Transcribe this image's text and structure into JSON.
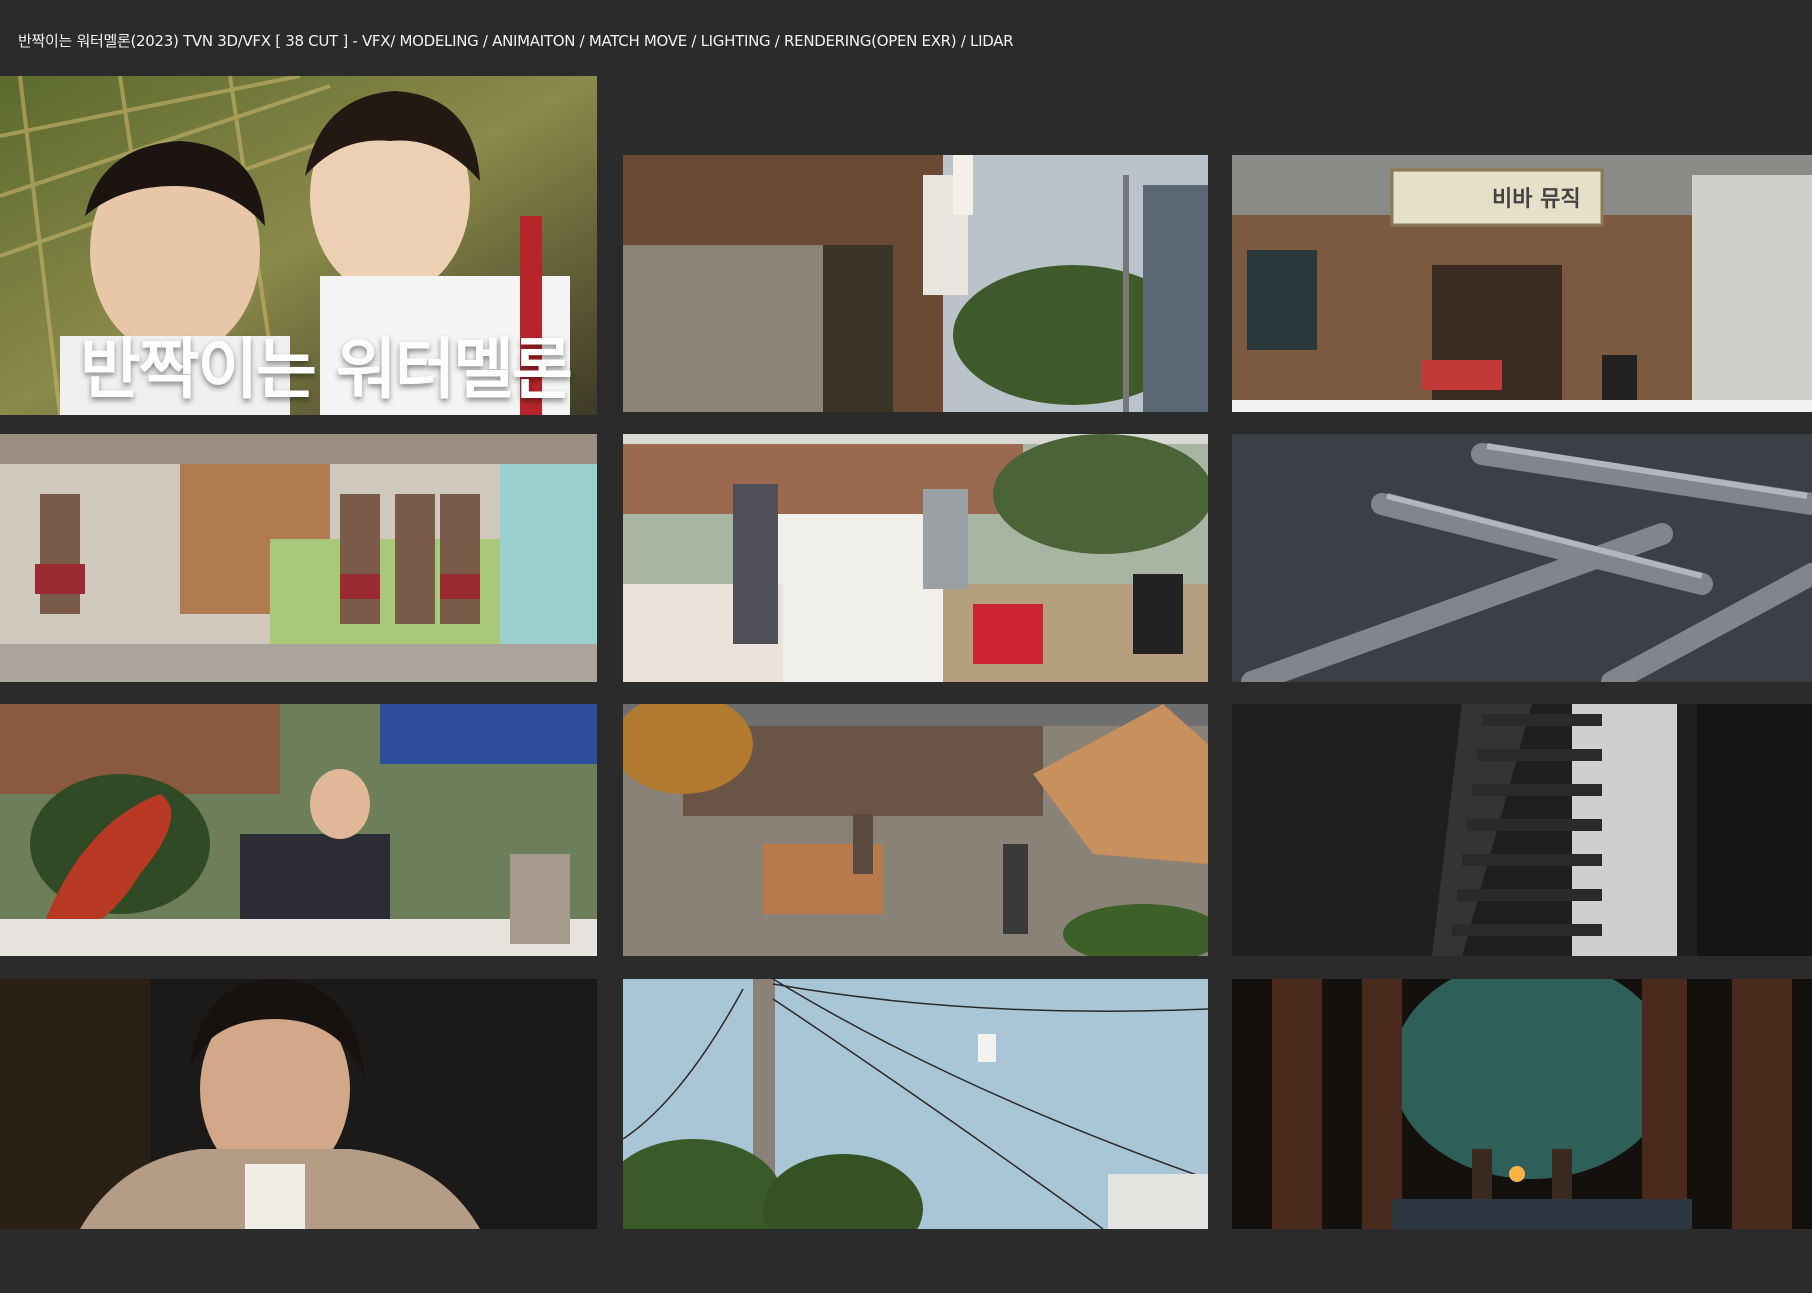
{
  "header": {
    "title": "반짝이는 워터멜론(2023) TVN 3D/VFX [ 38  CUT ] - VFX/ MODELING / ANIMAITON / MATCH MOVE / LIGHTING / RENDERING(OPEN EXR) / LIDAR"
  },
  "poster": {
    "title": "반짝이는 워터멜론"
  },
  "shop_sign": {
    "text": "비바 뮤직"
  }
}
